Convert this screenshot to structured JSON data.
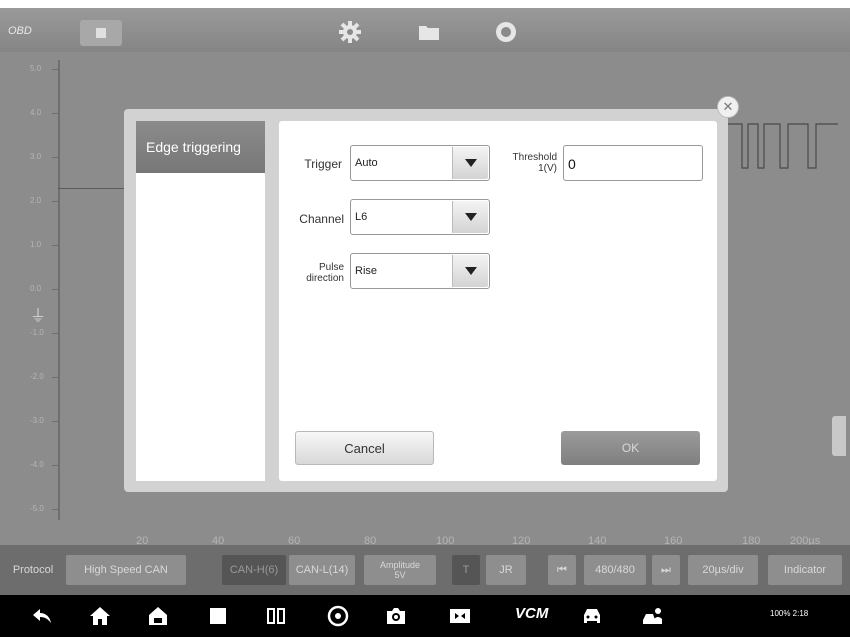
{
  "topbar": {
    "app_label": "OBD"
  },
  "scope": {
    "y_ticks": [
      "5.0",
      "4.0",
      "3.0",
      "2.0",
      "1.0",
      "0.0",
      "-1.0",
      "-2.0",
      "-3.0",
      "-4.0",
      "-5.0"
    ],
    "x_ticks": [
      "20",
      "40",
      "60",
      "80",
      "100",
      "120",
      "140",
      "160",
      "180",
      "200µs"
    ]
  },
  "modal": {
    "menu": {
      "selected": "Edge triggering"
    },
    "trigger": {
      "label": "Trigger",
      "value": "Auto"
    },
    "threshold": {
      "label_line1": "Threshold",
      "label_line2": "1(V)",
      "value": "0"
    },
    "channel": {
      "label": "Channel",
      "value": "L6"
    },
    "pulse": {
      "label_line1": "Pulse",
      "label_line2": "direction",
      "value": "Rise"
    },
    "cancel_label": "Cancel",
    "ok_label": "OK"
  },
  "bottombar": {
    "protocol_label": "Protocol",
    "protocol_value": "High Speed CAN",
    "can_h": "CAN-H(6)",
    "can_l": "CAN-L(14)",
    "amplitude_line1": "Amplitude",
    "amplitude_line2": "5V",
    "t_label": "T",
    "jr_label": "JR",
    "page_count": "480/480",
    "time_div": "20µs/div",
    "indicator_label": "Indicator"
  },
  "navbar": {
    "vci_label": "VCM",
    "status_text": "100% 2:18"
  }
}
